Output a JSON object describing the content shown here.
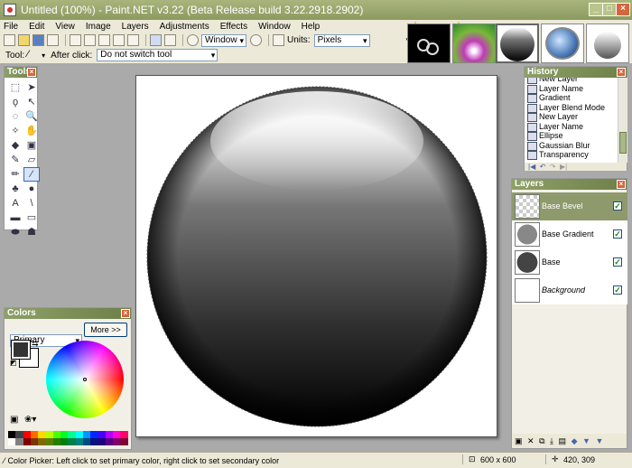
{
  "window": {
    "title": "Untitled (100%) - Paint.NET v3.22 (Beta Release build 3.22.2918.2902)"
  },
  "menu": [
    "File",
    "Edit",
    "View",
    "Image",
    "Layers",
    "Adjustments",
    "Effects",
    "Window",
    "Help"
  ],
  "toolbar": {
    "zoom_mode": "Window",
    "units_label": "Units:",
    "units_value": "Pixels"
  },
  "tool_options": {
    "tool_label": "Tool:",
    "after_click_label": "After click:",
    "after_click_value": "Do not switch tool"
  },
  "tools_panel": {
    "title": "Tools",
    "tools": [
      {
        "name": "rectangle-select-tool",
        "glyph": "⬚"
      },
      {
        "name": "move-selection-tool",
        "glyph": "➤"
      },
      {
        "name": "lasso-select-tool",
        "glyph": "ϙ"
      },
      {
        "name": "move-selected-tool",
        "glyph": "↖"
      },
      {
        "name": "ellipse-select-tool",
        "glyph": "◌"
      },
      {
        "name": "zoom-tool",
        "glyph": "🔍"
      },
      {
        "name": "magic-wand-tool",
        "glyph": "✧"
      },
      {
        "name": "pan-tool",
        "glyph": "✋"
      },
      {
        "name": "paint-bucket-tool",
        "glyph": "◆"
      },
      {
        "name": "gradient-tool",
        "glyph": "▣"
      },
      {
        "name": "paintbrush-tool",
        "glyph": "✎"
      },
      {
        "name": "eraser-tool",
        "glyph": "▱"
      },
      {
        "name": "pencil-tool",
        "glyph": "✏"
      },
      {
        "name": "color-picker-tool",
        "glyph": "⁄"
      },
      {
        "name": "clone-stamp-tool",
        "glyph": "♣"
      },
      {
        "name": "recolor-tool",
        "glyph": "●"
      },
      {
        "name": "text-tool",
        "glyph": "A"
      },
      {
        "name": "line-tool",
        "glyph": "\\"
      },
      {
        "name": "rectangle-tool",
        "glyph": "▬"
      },
      {
        "name": "rounded-rectangle-tool",
        "glyph": "▭"
      },
      {
        "name": "ellipse-tool",
        "glyph": "⬬"
      },
      {
        "name": "freeform-shape-tool",
        "glyph": "☗"
      }
    ]
  },
  "colors_panel": {
    "title": "Colors",
    "mode": "Primary",
    "more_button": "More >>"
  },
  "history_panel": {
    "title": "History",
    "items": [
      "New Layer",
      "Layer Name",
      "Gradient",
      "Layer Blend Mode",
      "New Layer",
      "Layer Name",
      "Ellipse",
      "Gaussian Blur",
      "Transparency"
    ]
  },
  "layers_panel": {
    "title": "Layers",
    "layers": [
      {
        "name": "Base Bevel",
        "visible": true,
        "selected": true
      },
      {
        "name": "Base Gradient",
        "visible": true,
        "selected": false
      },
      {
        "name": "Base",
        "visible": true,
        "selected": false
      },
      {
        "name": "Background",
        "visible": true,
        "selected": false
      }
    ]
  },
  "status": {
    "hint": "Color Picker: Left click to set primary color, right click to set secondary color",
    "image_size": "600 x 600",
    "cursor_pos": "420, 309"
  }
}
